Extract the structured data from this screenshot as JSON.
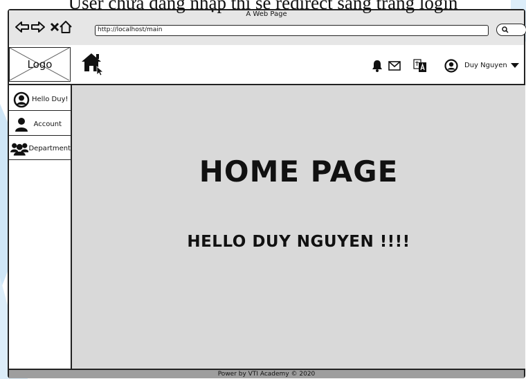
{
  "caption": "User chưa đăng nhập thì sẽ redirect sang trang login",
  "window": {
    "title": "A Web Page",
    "url": "http://localhost/main"
  },
  "header": {
    "logo_label": "Logo",
    "user_name": "Duy Nguyen",
    "icons": [
      "home-icon",
      "bell-icon",
      "mail-icon",
      "translate-icon",
      "user-icon",
      "caret-down-icon"
    ]
  },
  "sidebar": {
    "items": [
      {
        "label": "Hello Duy!",
        "icon": "user-circle-icon"
      },
      {
        "label": "Account",
        "icon": "person-icon"
      },
      {
        "label": "Department",
        "icon": "group-icon"
      }
    ]
  },
  "main": {
    "headline": "HOME PAGE",
    "subline": "HELLO DUY NGUYEN !!!!"
  },
  "footer": {
    "text": "Power by VTI Academy © 2020"
  },
  "colors": {
    "content_bg": "#d9d9d9",
    "footer_bg": "#9e9e9e",
    "decor_blue": "#cfe6f7"
  }
}
